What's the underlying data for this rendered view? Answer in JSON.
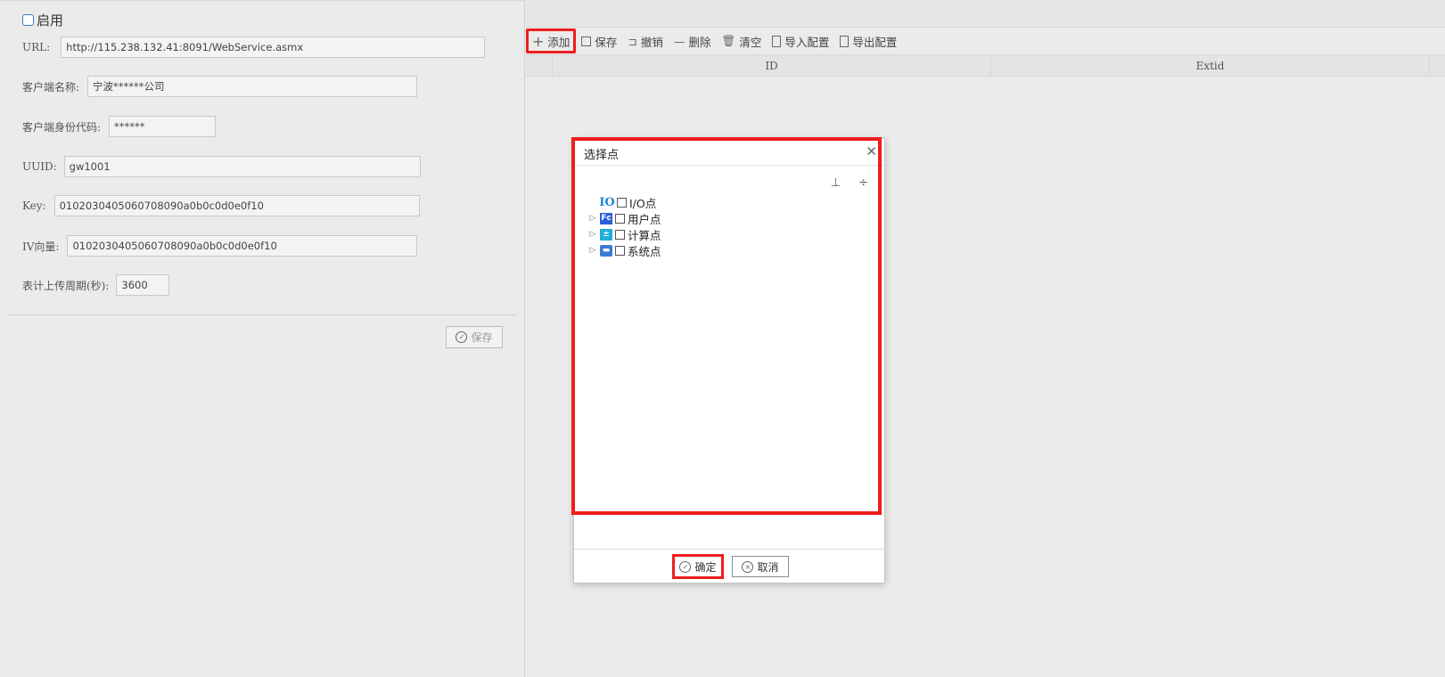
{
  "left": {
    "enable_label": "启用",
    "fields": [
      {
        "label": "URL:",
        "value": "http://115.238.132.41:8091/WebService.asmx"
      },
      {
        "label": "客户端名称:",
        "value": "宁波******公司"
      },
      {
        "label": "客户端身份代码:",
        "value": "******"
      },
      {
        "label": "UUID:",
        "value": "gw1001"
      },
      {
        "label": "Key:",
        "value": "0102030405060708090a0b0c0d0e0f10"
      },
      {
        "label": "IV向量:",
        "value": "0102030405060708090a0b0c0d0e0f10"
      },
      {
        "label": "表计上传周期(秒):",
        "value": "3600"
      }
    ],
    "save_label": "保存"
  },
  "toolbar": {
    "add": "添加",
    "save": "保存",
    "undo": "撤销",
    "delete": "删除",
    "clear": "清空",
    "import": "导入配置",
    "export": "导出配置"
  },
  "grid": {
    "columns": [
      "ID",
      "Extid"
    ]
  },
  "dialog": {
    "title": "选择点",
    "tree": [
      {
        "label": "I/O点",
        "icon": "io-icon",
        "expandable": false
      },
      {
        "label": "用户点",
        "icon": "user-point-icon",
        "expandable": true
      },
      {
        "label": "计算点",
        "icon": "calc-point-icon",
        "expandable": true
      },
      {
        "label": "系统点",
        "icon": "system-point-icon",
        "expandable": true
      }
    ],
    "ok": "确定",
    "cancel": "取消"
  },
  "colors": {
    "highlight": "#ee1d1d",
    "accent": "#3a7bd5"
  }
}
